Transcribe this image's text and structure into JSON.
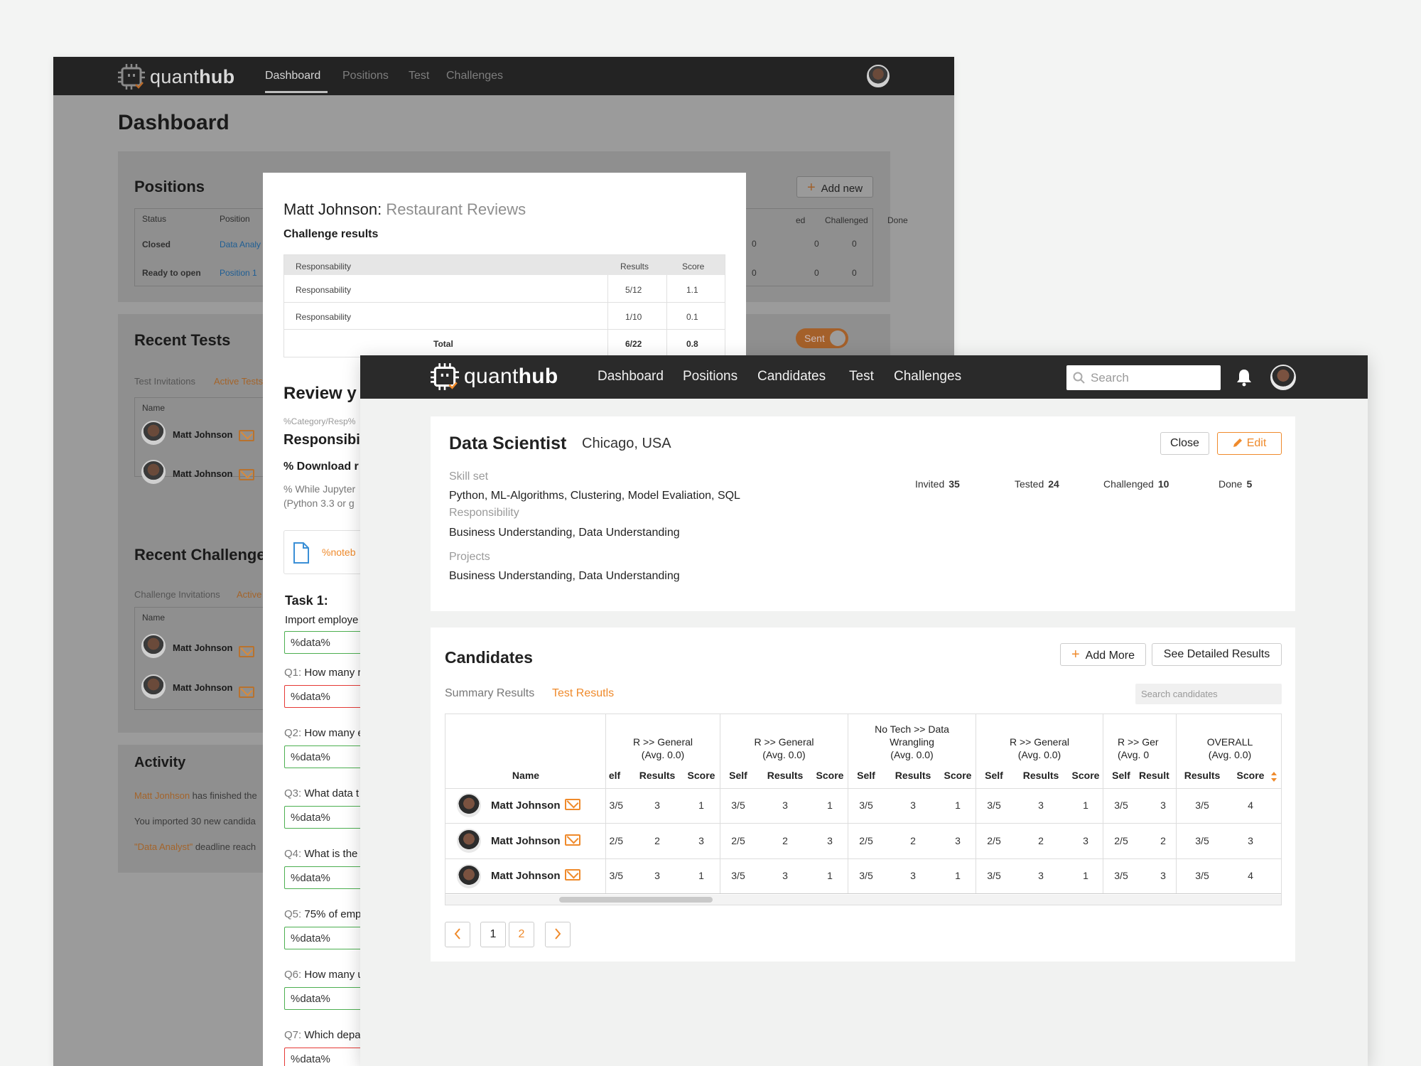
{
  "back": {
    "brand_a": "quant",
    "brand_b": "hub",
    "nav": [
      "Dashboard",
      "Positions",
      "Test",
      "Challenges"
    ],
    "page_title": "Dashboard",
    "positions": {
      "title": "Positions",
      "add_new": "Add new",
      "cols": [
        "Status",
        "Position",
        "ed",
        "Challenged",
        "Done"
      ],
      "rows": [
        {
          "status": "Closed",
          "position": "Data Analy",
          "a": "0",
          "b": "0",
          "c": "0"
        },
        {
          "status": "Ready to open",
          "position": "Position 1",
          "a": "0",
          "b": "0",
          "c": "0"
        }
      ]
    },
    "tests": {
      "title": "Recent Tests",
      "tab1": "Test Invitations",
      "tab2": "Active Tests",
      "col": "Name",
      "toggle": "Sent",
      "rows": [
        "Matt Johnson",
        "Matt Johnson"
      ]
    },
    "challenges": {
      "title": "Recent Challenge",
      "tab1": "Challenge Invitations",
      "tab2": "Active",
      "col": "Name",
      "rows": [
        "Matt Johnson",
        "Matt Johnson"
      ]
    },
    "activity": {
      "title": "Activity",
      "l1a": "Matt  Jonhson",
      "l1b": " has finished the",
      "l2": "You imported 30 new candida",
      "l3a": "\"Data Analyst\"",
      "l3b": " deadline reach"
    }
  },
  "modal": {
    "name": "Matt Johnson:",
    "challenge": "Restaurant Reviews",
    "sub": "Challenge results",
    "cols": [
      "Responsability",
      "Results",
      "Score"
    ],
    "rows": [
      {
        "r": "Responsability",
        "res": "5/12",
        "score": "1.1"
      },
      {
        "r": "Responsability",
        "res": "1/10",
        "score": "0.1"
      }
    ],
    "total": {
      "label": "Total",
      "res": "6/22",
      "score": "0.8"
    },
    "review": "Review y",
    "cat": "%Category/Resp%",
    "resp": "Responsibil",
    "download": "% Download r",
    "note1": "% While Jupyter",
    "note2": "(Python 3.3 or g",
    "file": "%noteb",
    "task": "Task 1:",
    "task_text": "Import employe",
    "data": "%data%",
    "questions": [
      {
        "n": "Q1:",
        "t": " How many r"
      },
      {
        "n": "Q2:",
        "t": " How many e"
      },
      {
        "n": "Q3:",
        "t": " What data t"
      },
      {
        "n": "Q4:",
        "t": " What is the"
      },
      {
        "n": "Q5:",
        "t": " 75% of emp"
      },
      {
        "n": "Q6:",
        "t": " How many u"
      },
      {
        "n": "Q7:",
        "t": " Which depa"
      }
    ]
  },
  "front": {
    "brand_a": "quant",
    "brand_b": "hub",
    "nav": [
      "Dashboard",
      "Positions",
      "Candidates",
      "Test",
      "Challenges"
    ],
    "search_placeholder": "Search",
    "position": {
      "title": "Data Scientist",
      "location": "Chicago, USA",
      "close": "Close",
      "edit": "Edit",
      "skill_label": "Skill set",
      "skill": "Python, ML-Algorithms, Clustering, Model Evaliation, SQL",
      "resp_label": "Responsibility",
      "resp": "Business Understanding, Data Understanding",
      "proj_label": "Projects",
      "proj": "Business Understanding, Data Understanding",
      "stats": [
        {
          "label": "Invited",
          "value": "35"
        },
        {
          "label": "Tested",
          "value": "24"
        },
        {
          "label": "Challenged",
          "value": "10"
        },
        {
          "label": "Done",
          "value": "5"
        }
      ]
    },
    "candidates": {
      "title": "Candidates",
      "add_more": "Add More",
      "detailed": "See Detailed Results",
      "tab1": "Summary Results",
      "tab2": "Test Resutls",
      "search_placeholder": "Search candidates",
      "name_col": "Name",
      "groups": [
        "R >> General\n(Avg. 0.0)",
        "R >> General\n(Avg. 0.0)",
        "No Tech >> Data\nWrangling\n(Avg. 0.0)",
        "R >> General\n(Avg. 0.0)",
        "R >> Ger\n(Avg. 0"
      ],
      "overall": "OVERALL\n(Avg. 0.0)",
      "sub": [
        "Self",
        "Results",
        "Score"
      ],
      "sub_first": "elf",
      "sub_last_cut": "Result",
      "rows": [
        {
          "name": "Matt Johnson",
          "first": "3/5",
          "self": "3/5",
          "res": "3",
          "score": "1",
          "oself": "3/5",
          "oscore": "4"
        },
        {
          "name": "Matt Johnson",
          "first": "2/5",
          "self": "2/5",
          "res": "2",
          "score": "3",
          "oself": "3/5",
          "oscore": "3"
        },
        {
          "name": "Matt Johnson",
          "first": "3/5",
          "self": "3/5",
          "res": "3",
          "score": "1",
          "oself": "3/5",
          "oscore": "4"
        }
      ],
      "pages": [
        "1",
        "2"
      ]
    }
  },
  "colors": {
    "accent": "#ef8a2b",
    "navbar": "#2a2a2a",
    "link": "#2d7fc1"
  }
}
